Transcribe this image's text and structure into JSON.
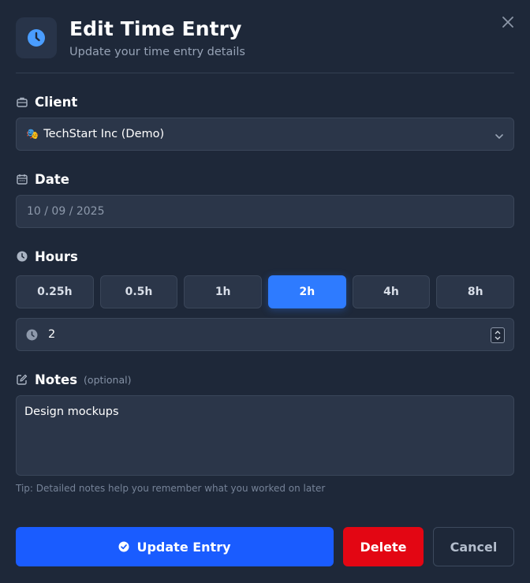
{
  "header": {
    "title": "Edit Time Entry",
    "subtitle": "Update your time entry details",
    "icon": "clock-icon",
    "close_icon": "close-icon"
  },
  "client": {
    "label": "Client",
    "icon": "briefcase-icon",
    "emoji": "🎭",
    "selected": "TechStart Inc (Demo)"
  },
  "date": {
    "label": "Date",
    "icon": "calendar-icon",
    "value": "10 / 09 / 2025"
  },
  "hours": {
    "label": "Hours",
    "icon": "clock-icon",
    "presets": [
      "0.25h",
      "0.5h",
      "1h",
      "2h",
      "4h",
      "8h"
    ],
    "selected_preset": "2h",
    "value": "2"
  },
  "notes": {
    "label": "Notes",
    "optional": "(optional)",
    "icon": "edit-icon",
    "value": "Design mockups",
    "tip": "Tip: Detailed notes help you remember what you worked on later"
  },
  "actions": {
    "update": "Update Entry",
    "delete": "Delete",
    "cancel": "Cancel"
  },
  "colors": {
    "background": "#1e2839",
    "accent": "#1a5cff",
    "active_preset": "#2e7bff",
    "danger": "#e30613"
  }
}
